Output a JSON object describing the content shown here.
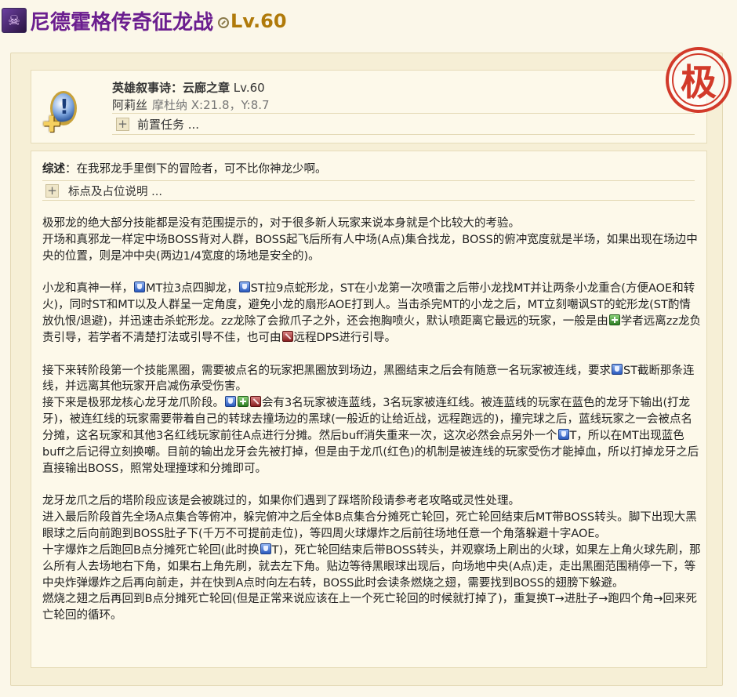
{
  "header": {
    "title": "尼德霍格传奇征龙战",
    "level": "Lv.60",
    "dungeon_icon": "dragon-face-icon",
    "level_icon": "sync-level-icon"
  },
  "stamp": {
    "text": "极",
    "color": "#d23a2a"
  },
  "quest": {
    "prefix": "英雄叙事诗：云廊之章",
    "level": "Lv.60",
    "npc": "阿莉丝",
    "location": "摩杜纳 X:21.8，Y:8.7",
    "prereq_label": "前置任务 ...",
    "icon": "quest-marker-icon"
  },
  "guide": {
    "summary_label": "综述",
    "summary_text": "：在我邪龙手里倒下的冒险者，可不比你神龙少啊。",
    "markers_label": "标点及占位说明 ...",
    "paragraphs": [
      [
        "极邪龙的绝大部分技能都是没有范围提示的，对于很多新人玩家来说本身就是个比较大的考验。"
      ],
      [
        "开场和真邪龙一样定中场BOSS背对人群，BOSS起飞后所有人中场(A点)集合找龙，BOSS的俯冲宽度就是半场，如果出现在场边中央的位置，则是冲中央(两边1/4宽度的场地是安全的)。"
      ],
      [
        "小龙和真神一样，",
        "MT拉3点四脚龙，",
        "ST拉9点蛇形龙，ST在小龙第一次喷雷之后带小龙找MT并让两条小龙重合(方便AOE和转火)，同时ST和MT以及人群呈一定角度，避免小龙的扇形AOE打到人。当击杀完MT的小龙之后，MT立刻嘲讽ST的蛇形龙(ST酌情放仇恨/退避)，并迅速击杀蛇形龙。zz龙除了会掀爪子之外，还会抱胸喷火，默认喷距离它最远的玩家，一般是由",
        "学者远离zz龙负责引导，若学者不清楚打法或引导不佳，也可由",
        "远程DPS进行引导。"
      ],
      [
        "接下来转阶段第一个技能黑圈，需要被点名的玩家把黑圈放到场边，黑圈结束之后会有随意一名玩家被连线，要求",
        "ST截断那条连线，并远离其他玩家开启减伤承受伤害。"
      ],
      [
        "接下来是极邪龙核心龙牙龙爪阶段。",
        "会有3名玩家被连蓝线，3名玩家被连红线。被连蓝线的玩家在蓝色的龙牙下输出(打龙牙)，被连红线的玩家需要带着自己的转球去撞场边的黑球(一般近的让给近战，远程跑远的)，撞完球之后，蓝线玩家之一会被点名分摊，这名玩家和其他3名红线玩家前往A点进行分摊。然后buff消失重来一次，这次必然会点另外一个",
        "T，所以在MT出现蓝色buff之后记得立刻换嘲。目前的输出龙牙会先被打掉，但是由于龙爪(红色)的机制是被连线的玩家受伤才能掉血，所以打掉龙牙之后直接输出BOSS，照常处理撞球和分摊即可。"
      ],
      [
        "龙牙龙爪之后的塔阶段应该是会被跳过的，如果你们遇到了踩塔阶段请参考老攻略或灵性处理。"
      ],
      [
        "进入最后阶段首先全场A点集合等俯冲，躲完俯冲之后全体B点集合分摊死亡轮回，死亡轮回结束后MT带BOSS转头。脚下出现大黑眼球之后向前跑到BOSS肚子下(千万不可提前走位)，等四周火球爆炸之后前往场地任意一个角落躲避十字AOE。"
      ],
      [
        "十字爆炸之后跑回B点分摊死亡轮回(此时换",
        "T)，死亡轮回结束后带BOSS转头，并观察场上刷出的火球，如果左上角火球先刷，那么所有人去场地右下角，如果右上角先刷，就去左下角。贴边等待黑眼球出现后，向场地中央(A点)走，走出黑圈范围稍停一下，等中央炸弹爆炸之后再向前走，并在快到A点时向左右转，BOSS此时会读条燃烧之翅，需要找到BOSS的翅膀下躲避。"
      ],
      [
        "燃烧之翅之后再回到B点分摊死亡轮回(但是正常来说应该在上一个死亡轮回的时候就打掉了)，重复换T→进肚子→跑四个角→回来死亡轮回的循环。"
      ]
    ]
  }
}
